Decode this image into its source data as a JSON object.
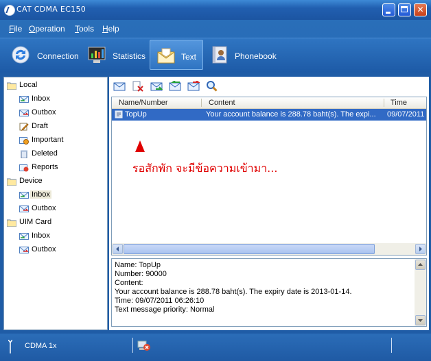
{
  "window": {
    "title": "CAT CDMA EC150"
  },
  "menu": [
    {
      "label": "File",
      "accel": "F",
      "rest": "ile"
    },
    {
      "label": "Operation",
      "accel": "O",
      "rest": "peration"
    },
    {
      "label": "Tools",
      "accel": "T",
      "rest": "ools"
    },
    {
      "label": "Help",
      "accel": "H",
      "rest": "elp"
    }
  ],
  "tabs": [
    {
      "label": "Connection",
      "icon": "connection-icon",
      "active": false
    },
    {
      "label": "Statistics",
      "icon": "statistics-icon",
      "active": false
    },
    {
      "label": "Text",
      "icon": "envelope-icon",
      "active": true
    },
    {
      "label": "Phonebook",
      "icon": "phonebook-icon",
      "active": false
    }
  ],
  "tree": {
    "local": {
      "label": "Local",
      "children": [
        "Inbox",
        "Outbox",
        "Draft",
        "Important",
        "Deleted",
        "Reports"
      ]
    },
    "device": {
      "label": "Device",
      "children": [
        "Inbox",
        "Outbox"
      ]
    },
    "uim": {
      "label": "UIM Card",
      "children": [
        "Inbox",
        "Outbox"
      ]
    },
    "selected": "Device/Inbox"
  },
  "actions": [
    "new-message-icon",
    "delete-message-icon",
    "forward-icon",
    "reply-icon",
    "resend-icon",
    "search-icon"
  ],
  "list": {
    "columns": [
      "Name/Number",
      "Content",
      "Time"
    ],
    "rows": [
      {
        "name": "TopUp",
        "content": "Your account balance is 288.78  baht(s). The expi...",
        "time": "09/07/2011"
      }
    ]
  },
  "annotation": "รอสักพัก จะมีข้อความเข้ามา...",
  "detail": {
    "name": "Name: TopUp",
    "number": "Number: 90000",
    "content_label": "Content:",
    "content": "Your account balance is 288.78  baht(s). The expiry date is 2013-01-14.",
    "time": "Time: 09/07/2011 06:26:10",
    "priority": "Text message priority: Normal"
  },
  "status": {
    "network": "CDMA 1x"
  },
  "colors": {
    "accent": "#1f5ca6",
    "selection": "#316ac5",
    "annotation": "#e00000"
  }
}
